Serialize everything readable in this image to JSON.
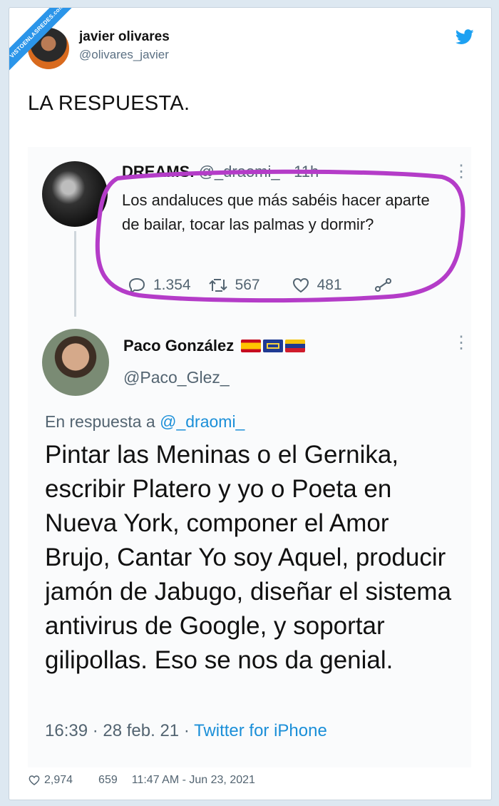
{
  "watermark": "VISTOENLASREDES.com",
  "tweet": {
    "author_name": "javier olivares",
    "author_handle": "@olivares_javier",
    "text": "LA RESPUESTA.",
    "footer": {
      "likes": "2,974",
      "retweets": "659",
      "timestamp": "11:47 AM - Jun 23, 2021"
    }
  },
  "quoted_tweet": {
    "user": "DREAMS.",
    "handle": "@_draomi_ · 11h",
    "text": "Los andaluces que más sabéis hacer aparte de bailar, tocar las palmas y dormir?",
    "replies": "1.354",
    "retweets": "567",
    "likes": "481"
  },
  "reply_tweet": {
    "name": "Paco González",
    "handle": "@Paco_Glez_",
    "reply_to_label": "En respuesta a",
    "reply_to_handle": "@_draomi_",
    "text": "Pintar las Meninas o el Gernika, escribir Platero y yo o Poeta en Nueva York, componer el Amor Brujo, Cantar Yo soy Aquel, producir jamón de Jabugo, diseñar el sistema antivirus de Google, y soportar gilipollas. Eso se nos da genial.",
    "time": "16:39 · 28 feb. 21",
    "source": "Twitter for iPhone"
  },
  "icons": [
    "twitter-bird-icon",
    "reply-icon",
    "retweet-icon",
    "heart-icon",
    "share-icon",
    "more-icon"
  ],
  "colors": {
    "twitter_blue": "#1da1f2",
    "highlight": "#b43cc8",
    "link": "#1b8fd8"
  }
}
